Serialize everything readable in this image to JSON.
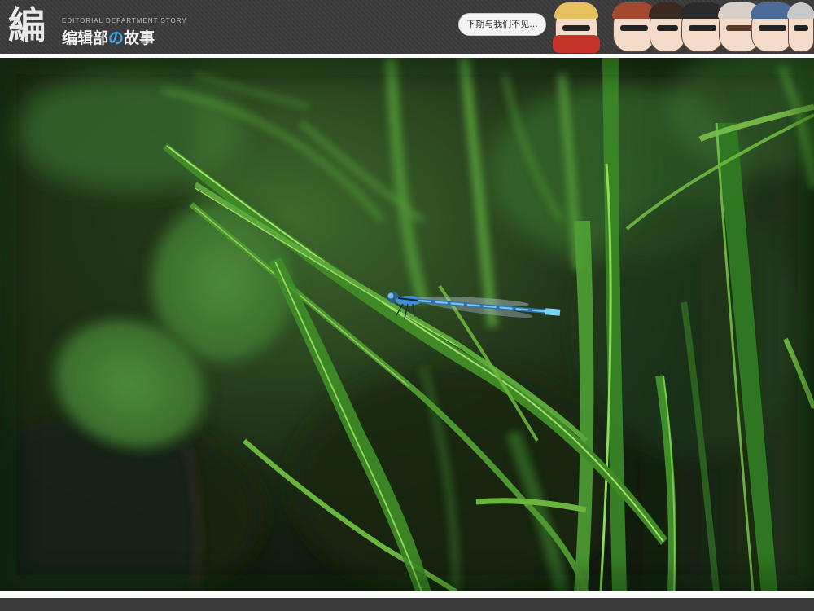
{
  "header": {
    "logo_mark": "編",
    "logo_subtitle": "EDITORIAL DEPARTMENT STORY",
    "logo_name_part1": "编辑部",
    "logo_name_accent": "の",
    "logo_name_part2": "故事",
    "speech_text": "下期与我们不见...",
    "colors": {
      "band": "#3b3b3b",
      "accent": "#3aa7e6"
    }
  },
  "photo": {
    "subject": "damselfly-on-grass",
    "colors": {
      "grass": "#4f9a2e",
      "damselfly": "#4aa0e0",
      "background": "#1c2a16"
    }
  }
}
